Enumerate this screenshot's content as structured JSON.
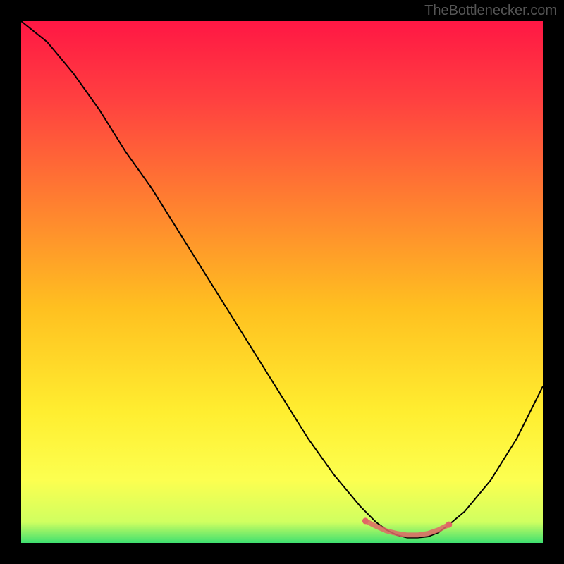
{
  "watermark": "TheBottlenecker.com",
  "chart_data": {
    "type": "line",
    "title": "",
    "xlabel": "",
    "ylabel": "",
    "xlim": [
      0,
      100
    ],
    "ylim": [
      0,
      100
    ],
    "series": [
      {
        "name": "curve",
        "x": [
          0,
          5,
          10,
          15,
          20,
          25,
          30,
          35,
          40,
          45,
          50,
          55,
          60,
          65,
          68,
          70,
          72,
          74,
          76,
          78,
          80,
          82,
          85,
          90,
          95,
          100
        ],
        "y": [
          100,
          96,
          90,
          83,
          75,
          68,
          60,
          52,
          44,
          36,
          28,
          20,
          13,
          7,
          4,
          2.5,
          1.5,
          1,
          1,
          1.2,
          2,
          3.5,
          6,
          12,
          20,
          30
        ]
      },
      {
        "name": "flat-highlight",
        "x": [
          66,
          68,
          70,
          72,
          74,
          76,
          78,
          80,
          82
        ],
        "y": [
          4.2,
          3.2,
          2.3,
          1.8,
          1.5,
          1.5,
          1.8,
          2.5,
          3.5
        ]
      }
    ],
    "background": {
      "type": "vertical-gradient",
      "stops": [
        {
          "offset": 0,
          "color": "#ff1744"
        },
        {
          "offset": 0.15,
          "color": "#ff4040"
        },
        {
          "offset": 0.35,
          "color": "#ff8030"
        },
        {
          "offset": 0.55,
          "color": "#ffc020"
        },
        {
          "offset": 0.75,
          "color": "#ffee30"
        },
        {
          "offset": 0.88,
          "color": "#fcff50"
        },
        {
          "offset": 0.96,
          "color": "#d0ff60"
        },
        {
          "offset": 1.0,
          "color": "#40e070"
        }
      ]
    },
    "highlight_color": "#e06666"
  }
}
